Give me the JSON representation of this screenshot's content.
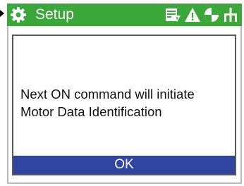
{
  "header": {
    "title": "Setup",
    "background_color": "#3ba639",
    "icons": [
      "gear-icon",
      "write-protect-icon",
      "warning-icon",
      "fault-icon",
      "network-icon"
    ]
  },
  "dialog": {
    "message_line1": "Next ON command will initiate",
    "message_line2": "Motor Data Identification",
    "ok_label": "OK",
    "ok_color": "#2f45a1"
  }
}
